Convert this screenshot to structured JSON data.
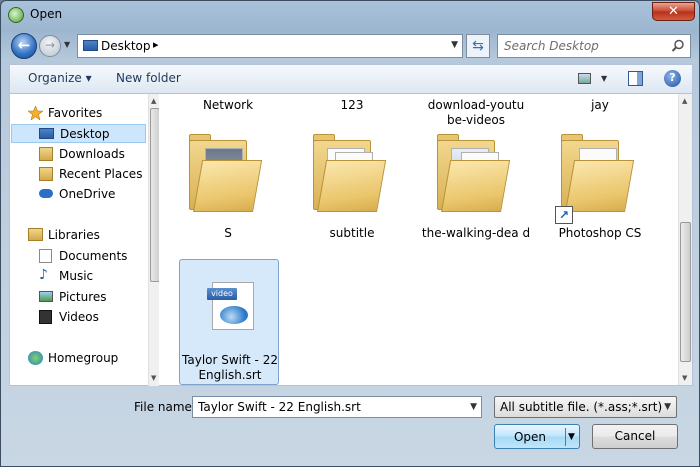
{
  "window": {
    "title": "Open",
    "close_glyph": "✕"
  },
  "nav": {
    "back_glyph": "←",
    "forward_glyph": "→",
    "address": "Desktop",
    "address_chevron": "▸",
    "search_placeholder": "Search Desktop"
  },
  "toolbar": {
    "organize": "Organize ▾",
    "new_folder": "New folder",
    "help": "?"
  },
  "sidebar": {
    "favorites": "Favorites",
    "desktop": "Desktop",
    "downloads": "Downloads",
    "recent_places": "Recent Places",
    "onedrive": "OneDrive",
    "libraries": "Libraries",
    "documents": "Documents",
    "music": "Music",
    "pictures": "Pictures",
    "videos": "Videos",
    "homegroup": "Homegroup"
  },
  "items": {
    "network": "Network",
    "n123": "123",
    "download_youtube": "download-youtu be-videos",
    "jay": "jay",
    "s": "S",
    "subtitle": "subtitle",
    "walking_dead": "the-walking-dea d",
    "photoshop": "Photoshop CS",
    "taylor": "Taylor Swift - 22 English.srt",
    "video_badge": "video"
  },
  "bottom": {
    "file_name_label": "File name:",
    "file_name_value": "Taylor Swift - 22 English.srt",
    "filter_value": "All subtitle file. (*.ass;*.srt)",
    "open": "Open",
    "cancel": "Cancel"
  },
  "colors": {
    "accent": "#3c7fb1",
    "selection": "#cde6fb",
    "folder": "#e8c670"
  }
}
